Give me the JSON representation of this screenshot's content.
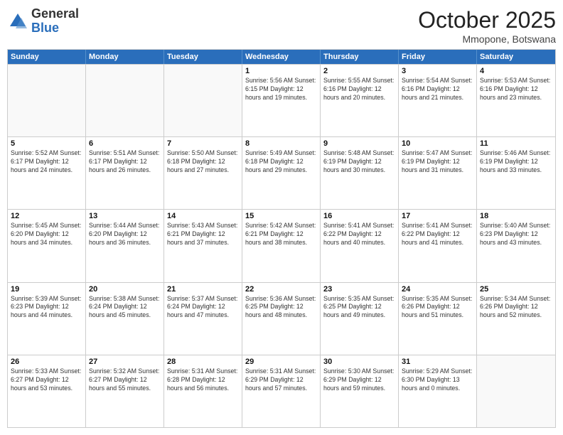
{
  "logo": {
    "general": "General",
    "blue": "Blue"
  },
  "title": "October 2025",
  "subtitle": "Mmopone, Botswana",
  "header_days": [
    "Sunday",
    "Monday",
    "Tuesday",
    "Wednesday",
    "Thursday",
    "Friday",
    "Saturday"
  ],
  "rows": [
    [
      {
        "day": "",
        "text": "",
        "empty": true
      },
      {
        "day": "",
        "text": "",
        "empty": true
      },
      {
        "day": "",
        "text": "",
        "empty": true
      },
      {
        "day": "1",
        "text": "Sunrise: 5:56 AM\nSunset: 6:15 PM\nDaylight: 12 hours\nand 19 minutes.",
        "empty": false
      },
      {
        "day": "2",
        "text": "Sunrise: 5:55 AM\nSunset: 6:16 PM\nDaylight: 12 hours\nand 20 minutes.",
        "empty": false
      },
      {
        "day": "3",
        "text": "Sunrise: 5:54 AM\nSunset: 6:16 PM\nDaylight: 12 hours\nand 21 minutes.",
        "empty": false
      },
      {
        "day": "4",
        "text": "Sunrise: 5:53 AM\nSunset: 6:16 PM\nDaylight: 12 hours\nand 23 minutes.",
        "empty": false
      }
    ],
    [
      {
        "day": "5",
        "text": "Sunrise: 5:52 AM\nSunset: 6:17 PM\nDaylight: 12 hours\nand 24 minutes.",
        "empty": false
      },
      {
        "day": "6",
        "text": "Sunrise: 5:51 AM\nSunset: 6:17 PM\nDaylight: 12 hours\nand 26 minutes.",
        "empty": false
      },
      {
        "day": "7",
        "text": "Sunrise: 5:50 AM\nSunset: 6:18 PM\nDaylight: 12 hours\nand 27 minutes.",
        "empty": false
      },
      {
        "day": "8",
        "text": "Sunrise: 5:49 AM\nSunset: 6:18 PM\nDaylight: 12 hours\nand 29 minutes.",
        "empty": false
      },
      {
        "day": "9",
        "text": "Sunrise: 5:48 AM\nSunset: 6:19 PM\nDaylight: 12 hours\nand 30 minutes.",
        "empty": false
      },
      {
        "day": "10",
        "text": "Sunrise: 5:47 AM\nSunset: 6:19 PM\nDaylight: 12 hours\nand 31 minutes.",
        "empty": false
      },
      {
        "day": "11",
        "text": "Sunrise: 5:46 AM\nSunset: 6:19 PM\nDaylight: 12 hours\nand 33 minutes.",
        "empty": false
      }
    ],
    [
      {
        "day": "12",
        "text": "Sunrise: 5:45 AM\nSunset: 6:20 PM\nDaylight: 12 hours\nand 34 minutes.",
        "empty": false
      },
      {
        "day": "13",
        "text": "Sunrise: 5:44 AM\nSunset: 6:20 PM\nDaylight: 12 hours\nand 36 minutes.",
        "empty": false
      },
      {
        "day": "14",
        "text": "Sunrise: 5:43 AM\nSunset: 6:21 PM\nDaylight: 12 hours\nand 37 minutes.",
        "empty": false
      },
      {
        "day": "15",
        "text": "Sunrise: 5:42 AM\nSunset: 6:21 PM\nDaylight: 12 hours\nand 38 minutes.",
        "empty": false
      },
      {
        "day": "16",
        "text": "Sunrise: 5:41 AM\nSunset: 6:22 PM\nDaylight: 12 hours\nand 40 minutes.",
        "empty": false
      },
      {
        "day": "17",
        "text": "Sunrise: 5:41 AM\nSunset: 6:22 PM\nDaylight: 12 hours\nand 41 minutes.",
        "empty": false
      },
      {
        "day": "18",
        "text": "Sunrise: 5:40 AM\nSunset: 6:23 PM\nDaylight: 12 hours\nand 43 minutes.",
        "empty": false
      }
    ],
    [
      {
        "day": "19",
        "text": "Sunrise: 5:39 AM\nSunset: 6:23 PM\nDaylight: 12 hours\nand 44 minutes.",
        "empty": false
      },
      {
        "day": "20",
        "text": "Sunrise: 5:38 AM\nSunset: 6:24 PM\nDaylight: 12 hours\nand 45 minutes.",
        "empty": false
      },
      {
        "day": "21",
        "text": "Sunrise: 5:37 AM\nSunset: 6:24 PM\nDaylight: 12 hours\nand 47 minutes.",
        "empty": false
      },
      {
        "day": "22",
        "text": "Sunrise: 5:36 AM\nSunset: 6:25 PM\nDaylight: 12 hours\nand 48 minutes.",
        "empty": false
      },
      {
        "day": "23",
        "text": "Sunrise: 5:35 AM\nSunset: 6:25 PM\nDaylight: 12 hours\nand 49 minutes.",
        "empty": false
      },
      {
        "day": "24",
        "text": "Sunrise: 5:35 AM\nSunset: 6:26 PM\nDaylight: 12 hours\nand 51 minutes.",
        "empty": false
      },
      {
        "day": "25",
        "text": "Sunrise: 5:34 AM\nSunset: 6:26 PM\nDaylight: 12 hours\nand 52 minutes.",
        "empty": false
      }
    ],
    [
      {
        "day": "26",
        "text": "Sunrise: 5:33 AM\nSunset: 6:27 PM\nDaylight: 12 hours\nand 53 minutes.",
        "empty": false
      },
      {
        "day": "27",
        "text": "Sunrise: 5:32 AM\nSunset: 6:27 PM\nDaylight: 12 hours\nand 55 minutes.",
        "empty": false
      },
      {
        "day": "28",
        "text": "Sunrise: 5:31 AM\nSunset: 6:28 PM\nDaylight: 12 hours\nand 56 minutes.",
        "empty": false
      },
      {
        "day": "29",
        "text": "Sunrise: 5:31 AM\nSunset: 6:29 PM\nDaylight: 12 hours\nand 57 minutes.",
        "empty": false
      },
      {
        "day": "30",
        "text": "Sunrise: 5:30 AM\nSunset: 6:29 PM\nDaylight: 12 hours\nand 59 minutes.",
        "empty": false
      },
      {
        "day": "31",
        "text": "Sunrise: 5:29 AM\nSunset: 6:30 PM\nDaylight: 13 hours\nand 0 minutes.",
        "empty": false
      },
      {
        "day": "",
        "text": "",
        "empty": true
      }
    ]
  ]
}
